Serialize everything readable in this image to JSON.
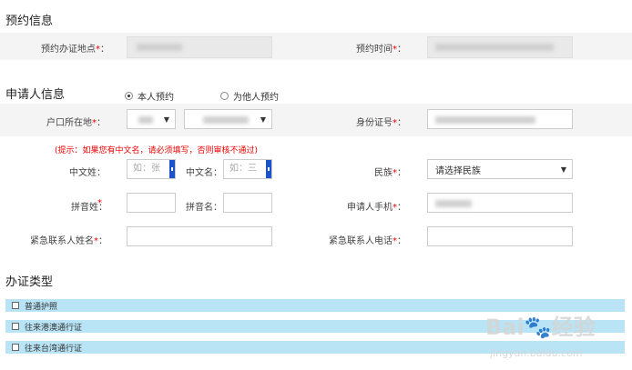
{
  "sections": {
    "reservation": "预约信息",
    "applicant": "申请人信息",
    "cert_type": "办证类型"
  },
  "reservation": {
    "location_label": "预约办证地点",
    "time_label": "预约时间"
  },
  "applicant": {
    "radio_self": "本人预约",
    "radio_other": "为他人预约",
    "household_label": "户口所在地",
    "id_label": "身份证号",
    "hint": "(提示：如果您有中文名，请必须填写，否则审核不通过)",
    "cn_surname_label": "中文姓：",
    "cn_surname_placeholder": "如：张",
    "cn_name_label": "中文名：",
    "cn_name_placeholder": "如：三",
    "ethnicity_label": "民族",
    "ethnicity_value": "请选择民族",
    "py_surname_label": "拼音姓：",
    "py_name_label": "拼音名：",
    "phone_label": "申请人手机",
    "emergency_name_label": "紧急联系人姓名",
    "emergency_phone_label": "紧急联系人电话"
  },
  "cert_types": [
    "普通护照",
    "往来港澳通行证",
    "往来台湾通行证"
  ],
  "watermark": {
    "brand": "Bai",
    "brand2": "经验",
    "url": "jingyan.baidu.com"
  },
  "colors": {
    "required": "#ee0000",
    "type_row_bg": "#b8e4f6",
    "cursor_tab": "#1d53c9"
  }
}
